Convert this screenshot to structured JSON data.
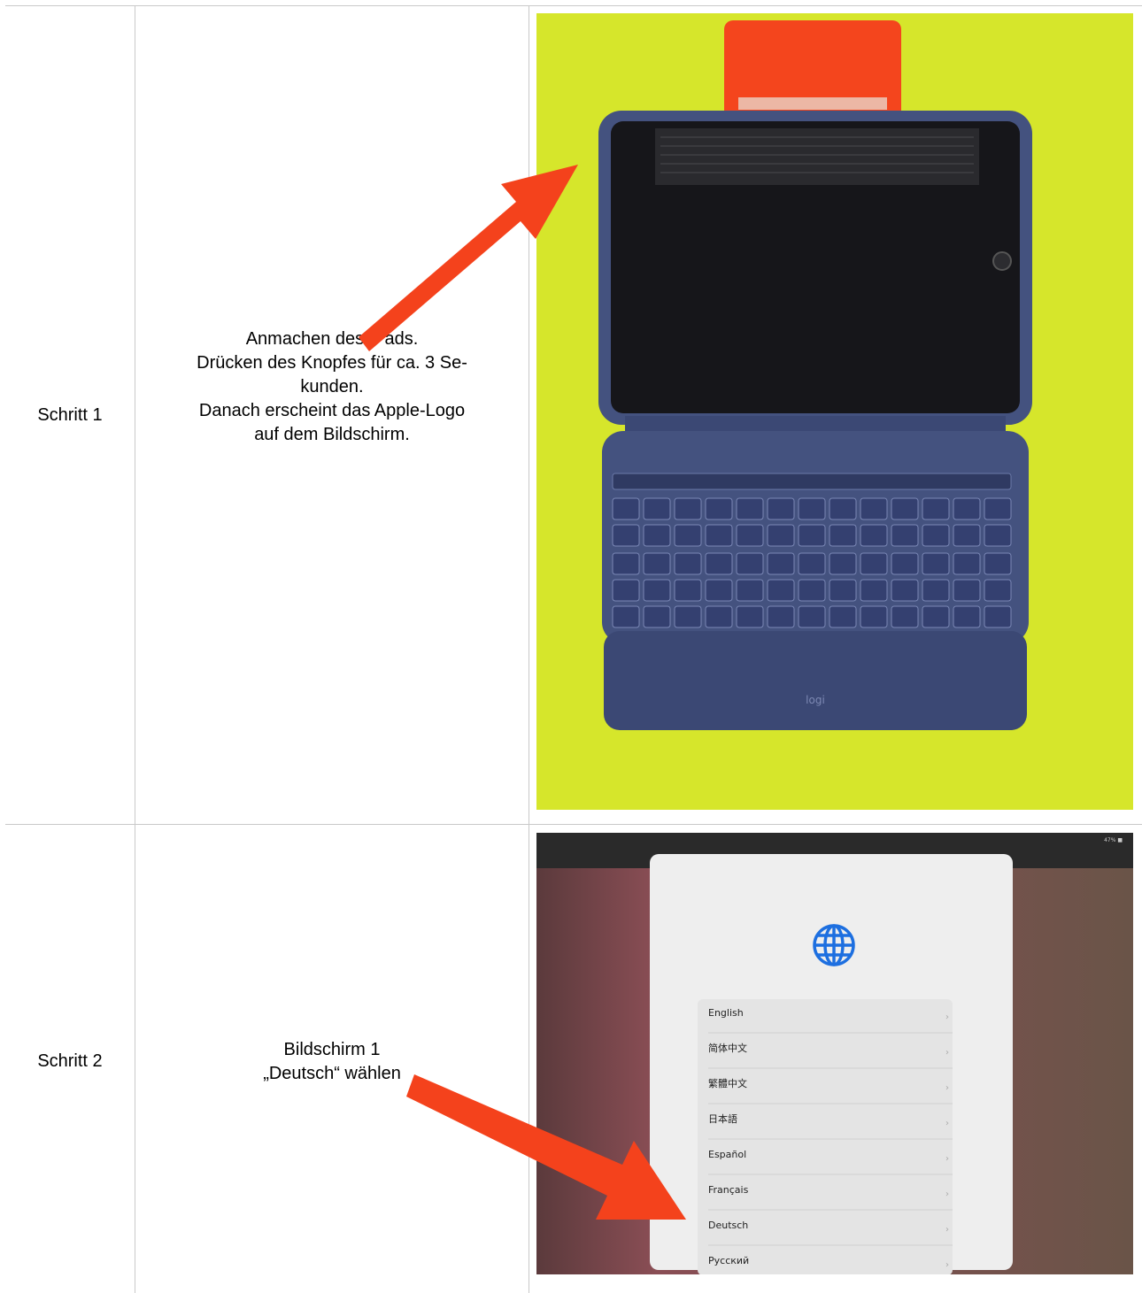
{
  "rows": [
    {
      "step_label": "Schritt 1",
      "description": [
        "Anmachen des iPads.",
        "Drücken des Knopfes für ca. 3 Se-",
        "kunden.",
        "Danach erscheint das Apple-Logo",
        "auf dem Bildschirm."
      ],
      "image": {
        "keyboard_brand": "logi"
      }
    },
    {
      "step_label": "Schritt 2",
      "description": [
        "Bildschirm 1",
        "„Deutsch“ wählen"
      ],
      "image": {
        "status": "47% ■",
        "languages": [
          "English",
          "简体中文",
          "繁體中文",
          "日本語",
          "Español",
          "Français",
          "Deutsch",
          "Русский"
        ]
      }
    }
  ],
  "colors": {
    "arrow": "#f4421c",
    "background_yellow": "#d6e62b",
    "case_blue": "#3f4d7e",
    "stand_orange": "#f4451d",
    "globe_blue": "#1d6fe0"
  }
}
